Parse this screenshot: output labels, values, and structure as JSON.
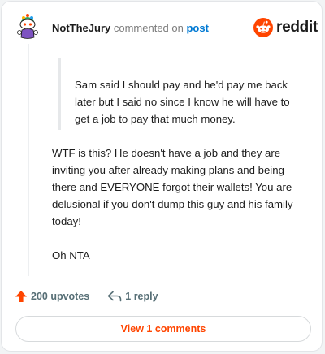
{
  "comment": {
    "username": "NotTheJury",
    "action_text": "commented on",
    "post_link": "post",
    "brand": "reddit",
    "quote": "Sam said I should pay and he'd pay me back later but I said no since I know he will have to get a job to pay that much money.",
    "paragraphs": [
      "WTF is this? He doesn't have a job and they are inviting you after already making plans and being there and EVERYONE forgot their wallets! You are delusional if you don't dump this guy and his family today!",
      "Oh NTA"
    ]
  },
  "footer": {
    "upvotes_label": "200 upvotes",
    "reply_label": "1 reply",
    "view_comments_label": "View 1 comments"
  },
  "colors": {
    "accent": "#ff4500",
    "link": "#0079d3",
    "muted": "#576f76"
  },
  "icons": {
    "avatar": "snoo-avatar",
    "brand": "reddit-logo-icon",
    "upvote": "upvote-arrow-icon",
    "reply": "reply-arrow-icon"
  }
}
